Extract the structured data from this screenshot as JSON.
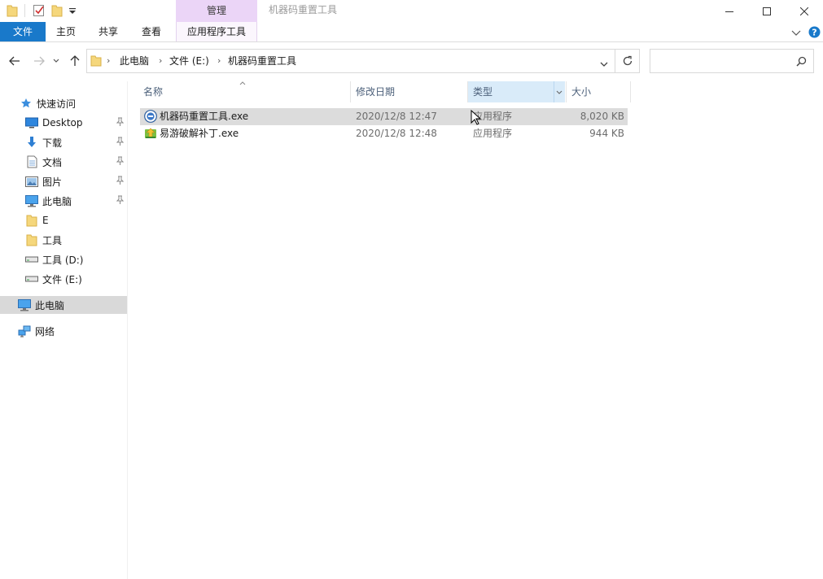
{
  "titlebar": {
    "manage_tab": "管理",
    "window_title": "机器码重置工具"
  },
  "ribbon": {
    "tabs": [
      "文件",
      "主页",
      "共享",
      "查看",
      "应用程序工具"
    ]
  },
  "address": {
    "crumbs": [
      "此电脑",
      "文件 (E:)",
      "机器码重置工具"
    ]
  },
  "search": {
    "placeholder": ""
  },
  "navpane": {
    "quick_access": "快速访问",
    "pinned": [
      {
        "label": "Desktop",
        "icon": "desktop-icon"
      },
      {
        "label": "下载",
        "icon": "download-icon"
      },
      {
        "label": "文档",
        "icon": "document-icon"
      },
      {
        "label": "图片",
        "icon": "pictures-icon"
      },
      {
        "label": "此电脑",
        "icon": "computer-icon"
      }
    ],
    "folders": [
      {
        "label": "E",
        "icon": "folder-icon"
      },
      {
        "label": "工具",
        "icon": "folder-icon"
      },
      {
        "label": "工具 (D:)",
        "icon": "drive-icon"
      },
      {
        "label": "文件 (E:)",
        "icon": "drive-icon"
      }
    ],
    "this_pc": "此电脑",
    "network": "网络"
  },
  "columns": {
    "name": "名称",
    "date": "修改日期",
    "type": "类型",
    "size": "大小"
  },
  "files": [
    {
      "name": "机器码重置工具.exe",
      "date": "2020/12/8 12:47",
      "type": "应用程序",
      "size": "8,020 KB"
    },
    {
      "name": "易游破解补丁.exe",
      "date": "2020/12/8 12:48",
      "type": "应用程序",
      "size": "944 KB"
    }
  ],
  "colors": {
    "file_tab": "#1979ca",
    "manage_header": "#ebd5f7",
    "selection": "#dcdcdc",
    "active_column": "#d9ebf9"
  }
}
